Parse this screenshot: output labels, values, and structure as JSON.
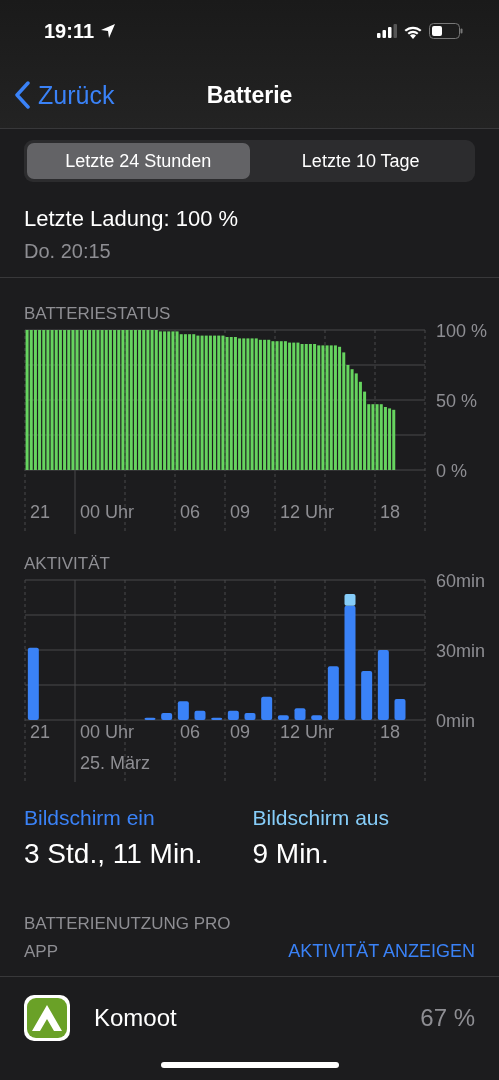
{
  "status_bar": {
    "time": "19:11"
  },
  "nav": {
    "back": "Zurück",
    "title": "Batterie"
  },
  "segments": [
    {
      "label": "Letzte 24 Stunden",
      "selected": true
    },
    {
      "label": "Letzte 10 Tage",
      "selected": false
    }
  ],
  "last_charge": {
    "label": "Letzte Ladung: 100 %",
    "time": "Do. 20:15"
  },
  "battery_status": {
    "x_labels": [
      "21",
      "00 Uhr",
      "06",
      "09",
      "12 Uhr",
      "18"
    ],
    "chart_data": {
      "type": "bar",
      "title": "BATTERIESTATUS",
      "ylim": [
        0,
        100
      ],
      "yticks": [
        {
          "value": 100,
          "label": "100 %"
        },
        {
          "value": 50,
          "label": "50 %"
        },
        {
          "value": 0,
          "label": "0 %"
        }
      ],
      "series": [
        {
          "color": "#66d45f",
          "values": [
            100,
            100,
            100,
            100,
            100,
            100,
            100,
            100,
            100,
            100,
            100,
            100,
            100,
            100,
            100,
            100,
            100,
            100,
            100,
            100,
            100,
            100,
            100,
            100,
            100,
            100,
            100,
            100,
            100,
            100,
            100,
            100,
            99,
            99,
            99,
            99,
            99,
            97,
            97,
            97,
            97,
            96,
            96,
            96,
            96,
            96,
            96,
            96,
            95,
            95,
            95,
            94,
            94,
            94,
            94,
            94,
            93,
            93,
            93,
            92,
            92,
            92,
            92,
            91,
            91,
            91,
            90,
            90,
            90,
            90,
            89,
            89,
            89,
            89,
            89,
            88,
            84,
            75,
            72,
            69,
            63,
            56,
            47,
            47,
            47,
            47,
            45,
            44,
            43,
            null,
            null,
            null,
            null,
            null,
            null,
            null
          ]
        }
      ]
    }
  },
  "activity": {
    "x_labels": [
      "21",
      "00 Uhr",
      "06",
      "09",
      "12 Uhr",
      "18"
    ],
    "date_label": "25. März",
    "chart_data": {
      "type": "bar",
      "title": "AKTIVITÄT",
      "stacked": true,
      "ylim": [
        0,
        60
      ],
      "yticks": [
        {
          "value": 60,
          "label": "60min"
        },
        {
          "value": 30,
          "label": "30min"
        },
        {
          "value": 0,
          "label": "0min"
        }
      ],
      "series": [
        {
          "name": "Bildschirm ein",
          "color": "#3a82f7",
          "values": [
            31,
            0,
            0,
            0,
            0,
            0,
            0,
            1,
            3,
            8,
            4,
            1,
            4,
            3,
            10,
            2,
            5,
            2,
            23,
            49,
            21,
            30,
            9,
            null
          ]
        },
        {
          "name": "Bildschirm aus",
          "color": "#86cdf9",
          "values": [
            0,
            0,
            0,
            0,
            0,
            0,
            0,
            0,
            0,
            0,
            0,
            0,
            0,
            0,
            0,
            0,
            0,
            0,
            0,
            5,
            0,
            0,
            0,
            null
          ]
        }
      ]
    }
  },
  "screen_time": [
    {
      "value": "3 Std., 11 Min."
    },
    {
      "value": "9 Min."
    }
  ],
  "usage": {
    "title": "BATTERIENUTZUNG PRO APP",
    "action": "AKTIVITÄT ANZEIGEN"
  },
  "apps": [
    {
      "name": "Komoot",
      "percent": "67 %"
    }
  ]
}
